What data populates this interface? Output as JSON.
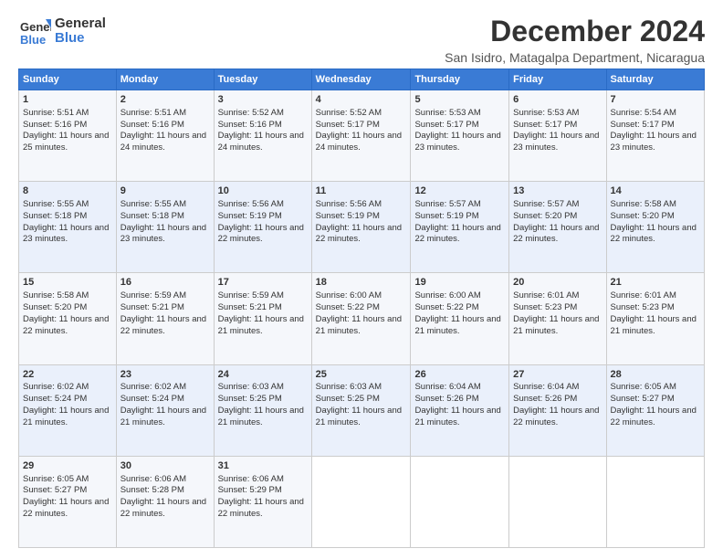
{
  "logo": {
    "general": "General",
    "blue": "Blue"
  },
  "title": "December 2024",
  "location": "San Isidro, Matagalpa Department, Nicaragua",
  "headers": [
    "Sunday",
    "Monday",
    "Tuesday",
    "Wednesday",
    "Thursday",
    "Friday",
    "Saturday"
  ],
  "weeks": [
    [
      {
        "day": "1",
        "sunrise": "5:51 AM",
        "sunset": "5:16 PM",
        "daylight": "11 hours and 25 minutes."
      },
      {
        "day": "2",
        "sunrise": "5:51 AM",
        "sunset": "5:16 PM",
        "daylight": "11 hours and 24 minutes."
      },
      {
        "day": "3",
        "sunrise": "5:52 AM",
        "sunset": "5:16 PM",
        "daylight": "11 hours and 24 minutes."
      },
      {
        "day": "4",
        "sunrise": "5:52 AM",
        "sunset": "5:17 PM",
        "daylight": "11 hours and 24 minutes."
      },
      {
        "day": "5",
        "sunrise": "5:53 AM",
        "sunset": "5:17 PM",
        "daylight": "11 hours and 23 minutes."
      },
      {
        "day": "6",
        "sunrise": "5:53 AM",
        "sunset": "5:17 PM",
        "daylight": "11 hours and 23 minutes."
      },
      {
        "day": "7",
        "sunrise": "5:54 AM",
        "sunset": "5:17 PM",
        "daylight": "11 hours and 23 minutes."
      }
    ],
    [
      {
        "day": "8",
        "sunrise": "5:55 AM",
        "sunset": "5:18 PM",
        "daylight": "11 hours and 23 minutes."
      },
      {
        "day": "9",
        "sunrise": "5:55 AM",
        "sunset": "5:18 PM",
        "daylight": "11 hours and 23 minutes."
      },
      {
        "day": "10",
        "sunrise": "5:56 AM",
        "sunset": "5:19 PM",
        "daylight": "11 hours and 22 minutes."
      },
      {
        "day": "11",
        "sunrise": "5:56 AM",
        "sunset": "5:19 PM",
        "daylight": "11 hours and 22 minutes."
      },
      {
        "day": "12",
        "sunrise": "5:57 AM",
        "sunset": "5:19 PM",
        "daylight": "11 hours and 22 minutes."
      },
      {
        "day": "13",
        "sunrise": "5:57 AM",
        "sunset": "5:20 PM",
        "daylight": "11 hours and 22 minutes."
      },
      {
        "day": "14",
        "sunrise": "5:58 AM",
        "sunset": "5:20 PM",
        "daylight": "11 hours and 22 minutes."
      }
    ],
    [
      {
        "day": "15",
        "sunrise": "5:58 AM",
        "sunset": "5:20 PM",
        "daylight": "11 hours and 22 minutes."
      },
      {
        "day": "16",
        "sunrise": "5:59 AM",
        "sunset": "5:21 PM",
        "daylight": "11 hours and 22 minutes."
      },
      {
        "day": "17",
        "sunrise": "5:59 AM",
        "sunset": "5:21 PM",
        "daylight": "11 hours and 21 minutes."
      },
      {
        "day": "18",
        "sunrise": "6:00 AM",
        "sunset": "5:22 PM",
        "daylight": "11 hours and 21 minutes."
      },
      {
        "day": "19",
        "sunrise": "6:00 AM",
        "sunset": "5:22 PM",
        "daylight": "11 hours and 21 minutes."
      },
      {
        "day": "20",
        "sunrise": "6:01 AM",
        "sunset": "5:23 PM",
        "daylight": "11 hours and 21 minutes."
      },
      {
        "day": "21",
        "sunrise": "6:01 AM",
        "sunset": "5:23 PM",
        "daylight": "11 hours and 21 minutes."
      }
    ],
    [
      {
        "day": "22",
        "sunrise": "6:02 AM",
        "sunset": "5:24 PM",
        "daylight": "11 hours and 21 minutes."
      },
      {
        "day": "23",
        "sunrise": "6:02 AM",
        "sunset": "5:24 PM",
        "daylight": "11 hours and 21 minutes."
      },
      {
        "day": "24",
        "sunrise": "6:03 AM",
        "sunset": "5:25 PM",
        "daylight": "11 hours and 21 minutes."
      },
      {
        "day": "25",
        "sunrise": "6:03 AM",
        "sunset": "5:25 PM",
        "daylight": "11 hours and 21 minutes."
      },
      {
        "day": "26",
        "sunrise": "6:04 AM",
        "sunset": "5:26 PM",
        "daylight": "11 hours and 21 minutes."
      },
      {
        "day": "27",
        "sunrise": "6:04 AM",
        "sunset": "5:26 PM",
        "daylight": "11 hours and 22 minutes."
      },
      {
        "day": "28",
        "sunrise": "6:05 AM",
        "sunset": "5:27 PM",
        "daylight": "11 hours and 22 minutes."
      }
    ],
    [
      {
        "day": "29",
        "sunrise": "6:05 AM",
        "sunset": "5:27 PM",
        "daylight": "11 hours and 22 minutes."
      },
      {
        "day": "30",
        "sunrise": "6:06 AM",
        "sunset": "5:28 PM",
        "daylight": "11 hours and 22 minutes."
      },
      {
        "day": "31",
        "sunrise": "6:06 AM",
        "sunset": "5:29 PM",
        "daylight": "11 hours and 22 minutes."
      },
      null,
      null,
      null,
      null
    ]
  ]
}
